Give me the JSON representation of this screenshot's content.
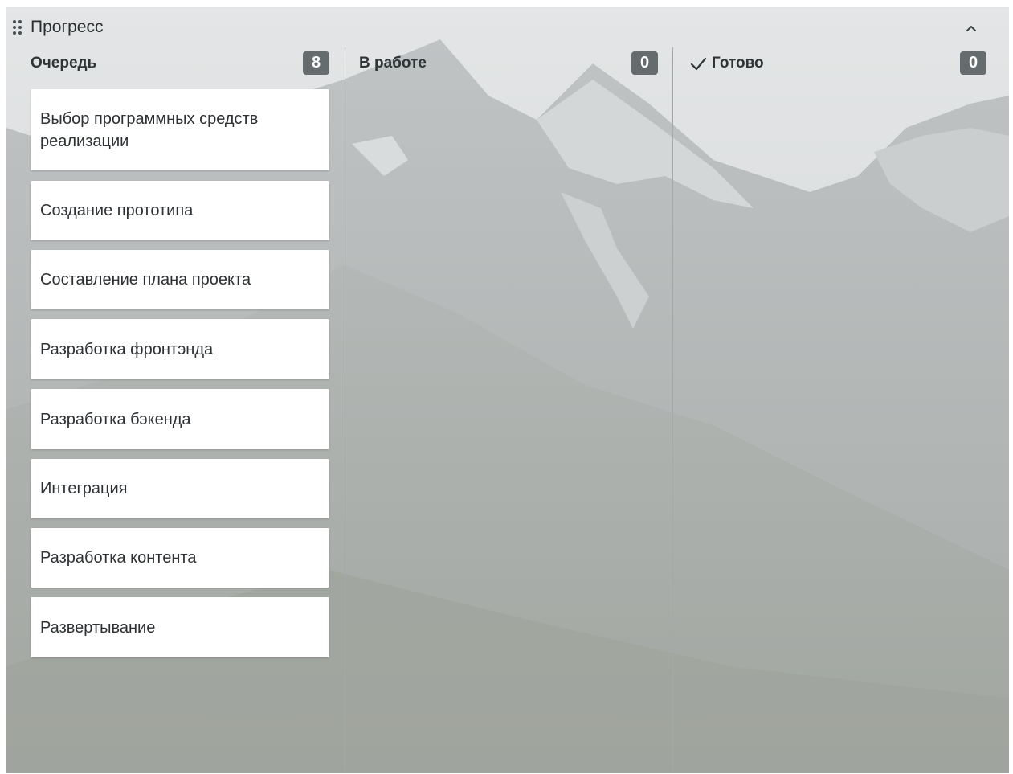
{
  "panel": {
    "title": "Прогресс"
  },
  "columns": [
    {
      "title": "Очередь",
      "count": "8",
      "cards": [
        "Выбор программных средств реализации",
        "Создание прототипа",
        "Составление плана проекта",
        "Разработка фронтэнда",
        "Разработка бэкенда",
        "Интеграция",
        "Разработка контента",
        "Развертывание"
      ]
    },
    {
      "title": "В работе",
      "count": "0",
      "cards": []
    },
    {
      "title": "Готово",
      "count": "0",
      "cards": []
    }
  ],
  "icons": {
    "drag": "drag-handle-icon",
    "collapse": "chevron-up-icon",
    "done": "check-icon"
  },
  "colors": {
    "badge": "#666b6d",
    "card": "#ffffff",
    "text": "#2d3133"
  }
}
